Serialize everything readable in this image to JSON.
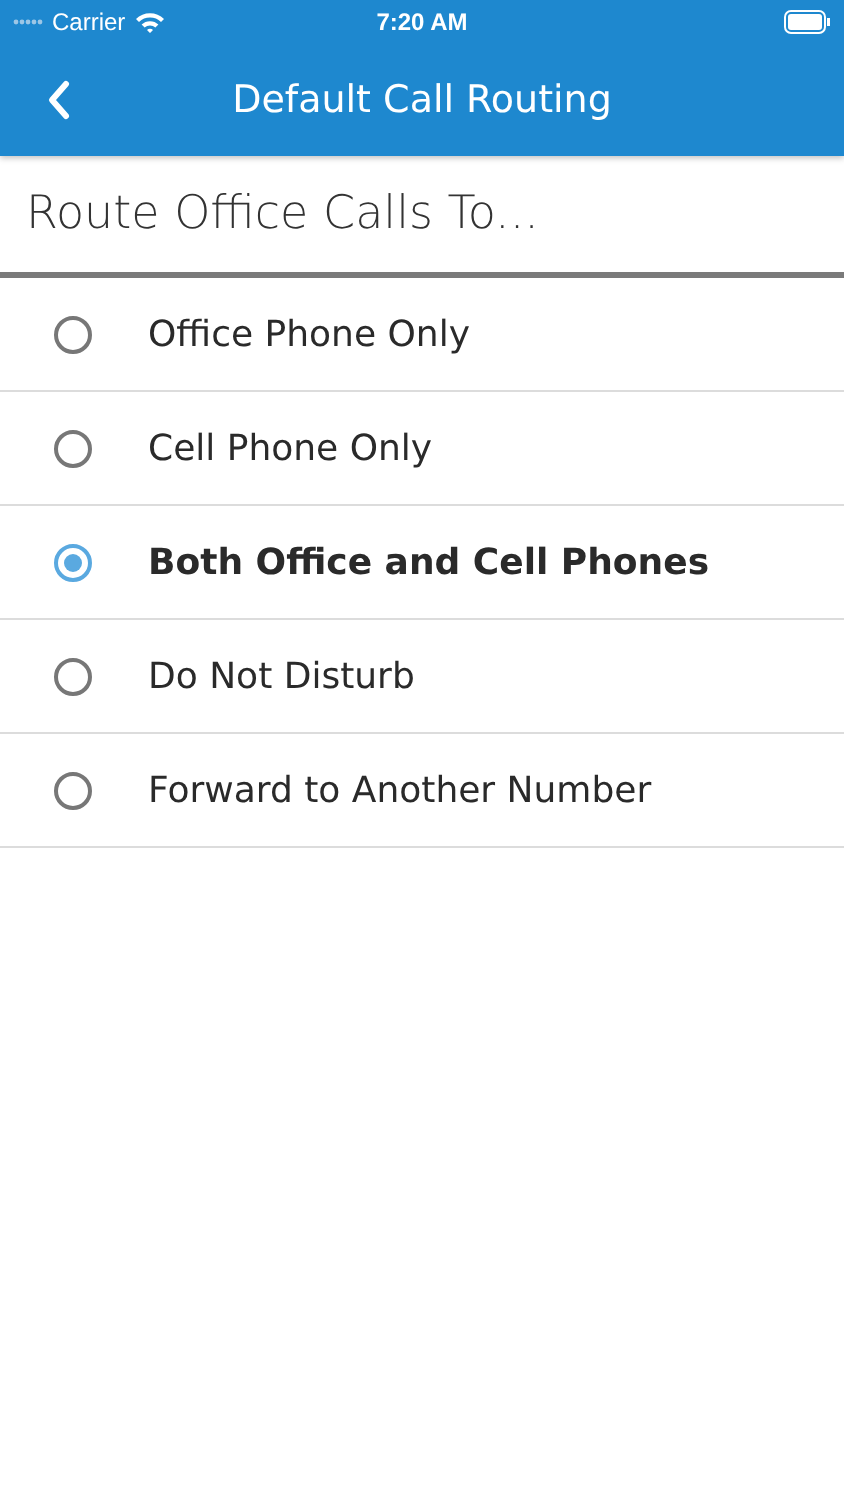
{
  "status_bar": {
    "carrier": "Carrier",
    "time": "7:20 AM"
  },
  "nav_bar": {
    "title": "Default Call Routing"
  },
  "section_title": "Route Office Calls To...",
  "options": [
    {
      "label": "Office Phone Only",
      "selected": false
    },
    {
      "label": "Cell Phone Only",
      "selected": false
    },
    {
      "label": "Both Office and Cell Phones",
      "selected": true
    },
    {
      "label": "Do Not Disturb",
      "selected": false
    },
    {
      "label": "Forward to Another Number",
      "selected": false
    }
  ]
}
